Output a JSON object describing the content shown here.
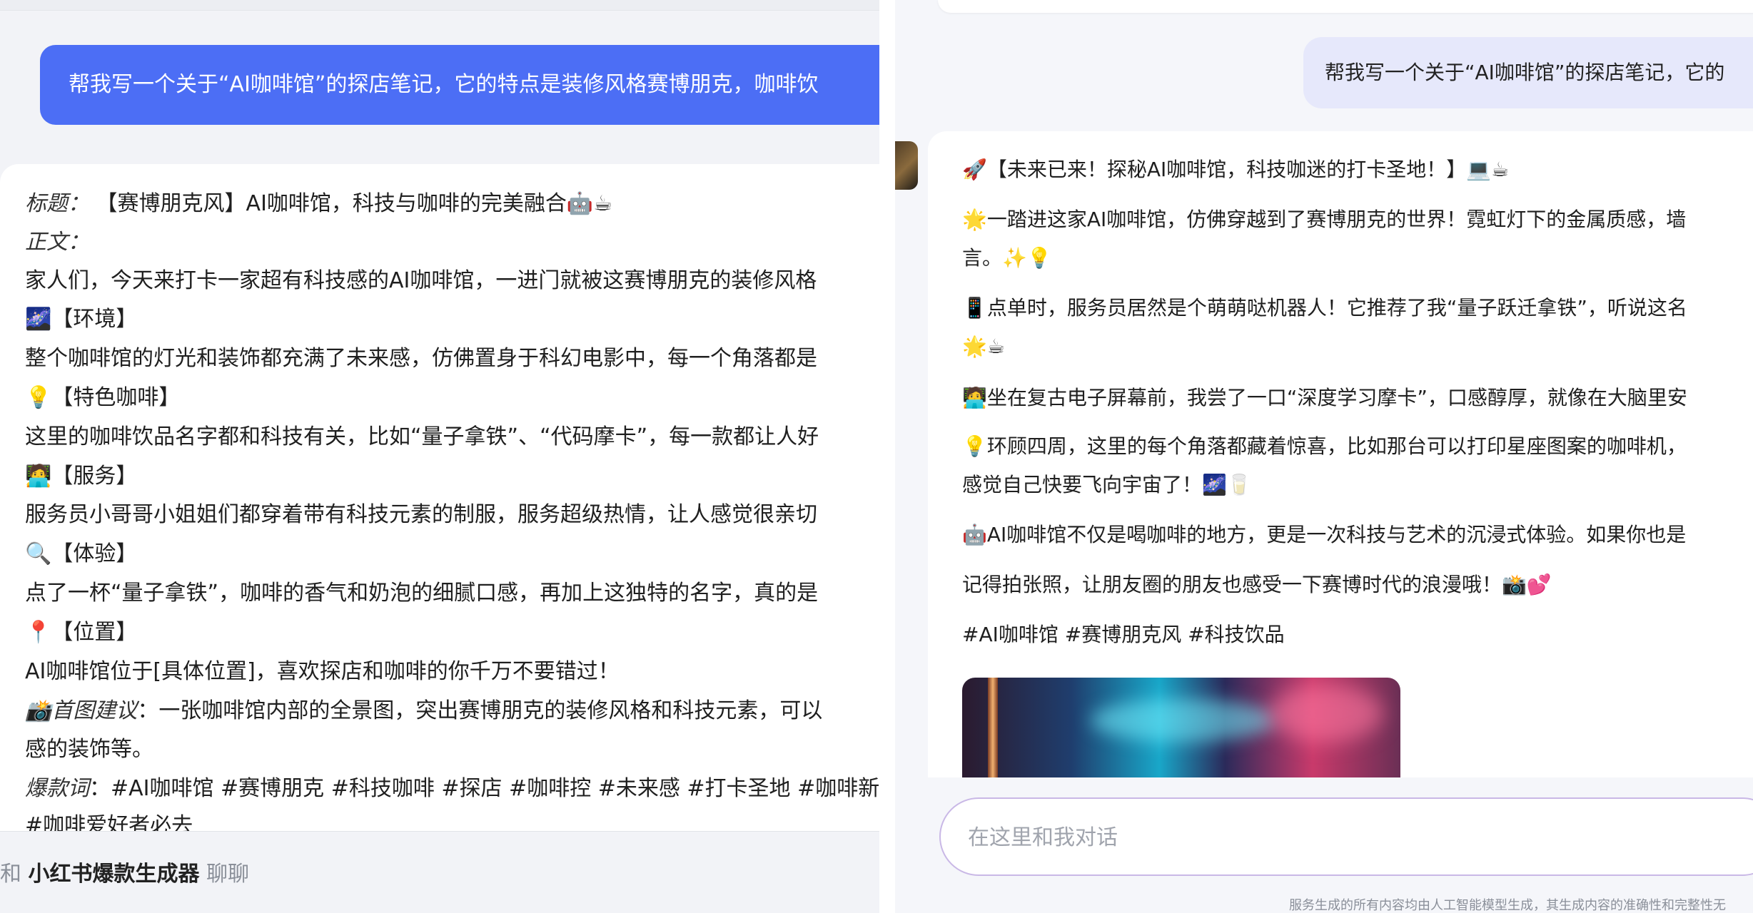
{
  "left": {
    "user_message": "帮我写一个关于“AI咖啡馆”的探店笔记，它的特点是装修风格赛博朋克，咖啡饮",
    "response": {
      "title_label": "标题",
      "title_value": "【赛博朋克风】AI咖啡馆，科技与咖啡的完美融合🤖☕",
      "body_label": "正文",
      "intro": "家人们，今天来打卡一家超有科技感的AI咖啡馆，一进门就被这赛博朋克的装修风格",
      "section_env": "🌌【环境】",
      "env_text": "整个咖啡馆的灯光和装饰都充满了未来感，仿佛置身于科幻电影中，每一个角落都是",
      "section_coffee": "💡【特色咖啡】",
      "coffee_text": "这里的咖啡饮品名字都和科技有关，比如“量子拿铁”、“代码摩卡”，每一款都让人好",
      "section_service": "🧑‍💻【服务】",
      "service_text": "服务员小哥哥小姐姐们都穿着带有科技元素的制服，服务超级热情，让人感觉很亲切",
      "section_experience": "🔍【体验】",
      "experience_text": "点了一杯“量子拿铁”，咖啡的香气和奶泡的细腻口感，再加上这独特的名字，真的是",
      "section_location": "📍【位置】",
      "location_text": "AI咖啡馆位于[具体位置]，喜欢探店和咖啡的你千万不要错过！",
      "cover_label": "📸首图建议",
      "cover_text": "：一张咖啡馆内部的全景图，突出赛博朋克的装修风格和科技元素，可以",
      "cover_text2": "感的装饰等。",
      "keywords_label": "爆款词",
      "keywords_text": "：#AI咖啡馆 #赛博朋克 #科技咖啡 #探店 #咖啡控 #未来感 #打卡圣地 #咖啡新",
      "keywords_text2": "#咖啡爱好者必去"
    },
    "footer": {
      "prefix": "和",
      "bot_name": "小红书爆款生成器",
      "suffix": "聊聊"
    }
  },
  "right": {
    "user_message": "帮我写一个关于“AI咖啡馆”的探店笔记，它的",
    "response": {
      "headline": "🚀【未来已来！探秘AI咖啡馆，科技咖迷的打卡圣地！】💻☕",
      "p1": "🌟一踏进这家AI咖啡馆，仿佛穿越到了赛博朋克的世界！霓虹灯下的金属质感，墙",
      "p1b": "言。✨💡",
      "p2": "📱点单时，服务员居然是个萌萌哒机器人！它推荐了我“量子跃迁拿铁”，听说这名",
      "p2b": "🌟☕",
      "p3": "🧑‍💻坐在复古电子屏幕前，我尝了一口“深度学习摩卡”，口感醇厚，就像在大脑里安",
      "p4": "💡环顾四周，这里的每个角落都藏着惊喜，比如那台可以打印星座图案的咖啡机，",
      "p4b": "感觉自己快要飞向宇宙了！🌌🥛",
      "p5": "🤖AI咖啡馆不仅是喝咖啡的地方，更是一次科技与艺术的沉浸式体验。如果你也是",
      "p6": "记得拍张照，让朋友圈的朋友也感受一下赛博时代的浪漫哦！📸💕",
      "tags": "#AI咖啡馆 #赛博朋克风 #科技饮品"
    },
    "input": {
      "placeholder": "在这里和我对话"
    },
    "disclaimer": "服务生成的所有内容均由人工智能模型生成，其生成内容的准确性和完整性无"
  }
}
